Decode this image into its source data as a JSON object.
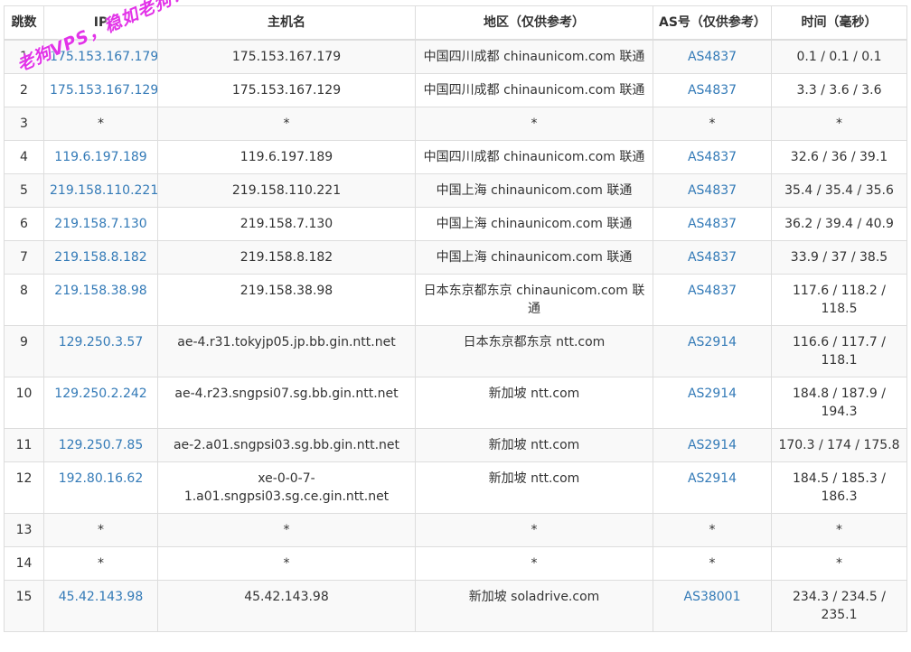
{
  "headers": {
    "hop": "跳数",
    "ip": "IP",
    "host": "主机名",
    "region": "地区（仅供参考）",
    "as": "AS号（仅供参考）",
    "time": "时间（毫秒）"
  },
  "rows": [
    {
      "hop": "1",
      "ip": "175.153.167.179",
      "host": "175.153.167.179",
      "region": "中国四川成都 chinaunicom.com 联通",
      "as": "AS4837",
      "time": "0.1 / 0.1 / 0.1"
    },
    {
      "hop": "2",
      "ip": "175.153.167.129",
      "host": "175.153.167.129",
      "region": "中国四川成都 chinaunicom.com 联通",
      "as": "AS4837",
      "time": "3.3 / 3.6 / 3.6"
    },
    {
      "hop": "3",
      "ip": "*",
      "host": "*",
      "region": "*",
      "as": "*",
      "time": "*"
    },
    {
      "hop": "4",
      "ip": "119.6.197.189",
      "host": "119.6.197.189",
      "region": "中国四川成都 chinaunicom.com 联通",
      "as": "AS4837",
      "time": "32.6 / 36 / 39.1"
    },
    {
      "hop": "5",
      "ip": "219.158.110.221",
      "host": "219.158.110.221",
      "region": "中国上海 chinaunicom.com 联通",
      "as": "AS4837",
      "time": "35.4 / 35.4 / 35.6"
    },
    {
      "hop": "6",
      "ip": "219.158.7.130",
      "host": "219.158.7.130",
      "region": "中国上海 chinaunicom.com 联通",
      "as": "AS4837",
      "time": "36.2 / 39.4 / 40.9"
    },
    {
      "hop": "7",
      "ip": "219.158.8.182",
      "host": "219.158.8.182",
      "region": "中国上海 chinaunicom.com 联通",
      "as": "AS4837",
      "time": "33.9 / 37 / 38.5"
    },
    {
      "hop": "8",
      "ip": "219.158.38.98",
      "host": "219.158.38.98",
      "region": "日本东京都东京 chinaunicom.com 联通",
      "as": "AS4837",
      "time": "117.6 / 118.2 / 118.5"
    },
    {
      "hop": "9",
      "ip": "129.250.3.57",
      "host": "ae-4.r31.tokyjp05.jp.bb.gin.ntt.net",
      "region": "日本东京都东京 ntt.com",
      "as": "AS2914",
      "time": "116.6 / 117.7 / 118.1"
    },
    {
      "hop": "10",
      "ip": "129.250.2.242",
      "host": "ae-4.r23.sngpsi07.sg.bb.gin.ntt.net",
      "region": "新加坡 ntt.com",
      "as": "AS2914",
      "time": "184.8 / 187.9 / 194.3"
    },
    {
      "hop": "11",
      "ip": "129.250.7.85",
      "host": "ae-2.a01.sngpsi03.sg.bb.gin.ntt.net",
      "region": "新加坡 ntt.com",
      "as": "AS2914",
      "time": "170.3 / 174 / 175.8"
    },
    {
      "hop": "12",
      "ip": "192.80.16.62",
      "host": "xe-0-0-7-1.a01.sngpsi03.sg.ce.gin.ntt.net",
      "region": "新加坡 ntt.com",
      "as": "AS2914",
      "time": "184.5 / 185.3 / 186.3"
    },
    {
      "hop": "13",
      "ip": "*",
      "host": "*",
      "region": "*",
      "as": "*",
      "time": "*"
    },
    {
      "hop": "14",
      "ip": "*",
      "host": "*",
      "region": "*",
      "as": "*",
      "time": "*"
    },
    {
      "hop": "15",
      "ip": "45.42.143.98",
      "host": "45.42.143.98",
      "region": "新加坡 soladrive.com",
      "as": "AS38001",
      "time": "234.3 / 234.5 / 235.1"
    }
  ],
  "watermark": "老狗VPS，稳如老狗！",
  "colors": {
    "link": "#337ab7",
    "watermark": "#e233e8",
    "border": "#dddddd",
    "stripe": "#f9f9f9"
  }
}
